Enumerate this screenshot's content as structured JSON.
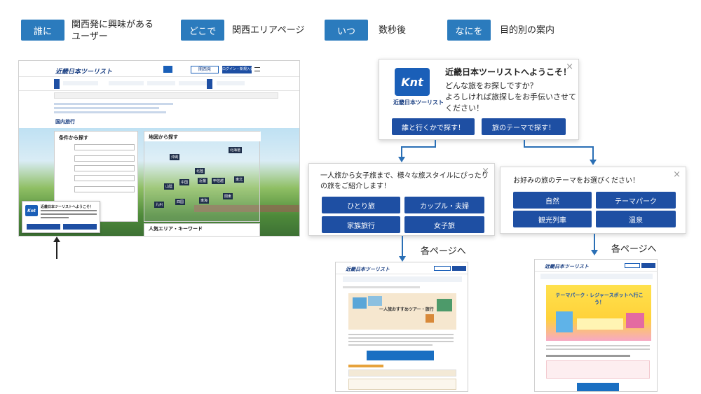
{
  "header_tags": [
    {
      "tag": "誰に",
      "text_line1": "関西発に興味がある",
      "text_line2": "ユーザー"
    },
    {
      "tag": "どこで",
      "text_line1": "関西エリアページ",
      "text_line2": ""
    },
    {
      "tag": "いつ",
      "text_line1": "数秒後",
      "text_line2": ""
    },
    {
      "tag": "なにを",
      "text_line1": "目的別の案内",
      "text_line2": ""
    }
  ],
  "site": {
    "brand": "近畿日本ツーリスト",
    "section_title": "国内旅行",
    "search_label": "条件から探す",
    "map_label": "地図から探す",
    "keyword_label": "人気エリア・キーワード",
    "login": "ログイン・新規入会",
    "region": "関西発",
    "map_regions": [
      "北海道",
      "東北",
      "関東",
      "甲信越",
      "北陸",
      "東海",
      "近畿",
      "中国",
      "四国",
      "九州",
      "沖縄",
      "山陰"
    ]
  },
  "welcome_popup": {
    "logo_text": "Knt",
    "logo_sub": "近畿日本ツーリスト",
    "title": "近畿日本ツーリストへようこそ！",
    "body_line1": "どんな旅をお探しですか？",
    "body_line2": "よろしければ旅探しをお手伝いさせて",
    "body_line3": "ください！",
    "btn_who": "誰と行くかで探す！",
    "btn_theme": "旅のテーマで探す！",
    "close": "×"
  },
  "who_popup": {
    "text_line1": "一人旅から女子旅まで、様々な旅スタイルにぴったり",
    "text_line2": "の旅をご紹介します！",
    "options": [
      "ひとり旅",
      "カップル・夫婦",
      "家族旅行",
      "女子旅"
    ],
    "close": "×"
  },
  "theme_popup": {
    "text_line1": "お好みの旅のテーマをお選びください！",
    "options": [
      "自然",
      "テーマパーク",
      "観光列車",
      "温泉"
    ],
    "close": "×"
  },
  "captions": {
    "left": "各ページへ",
    "right": "各ページへ"
  },
  "result_pages": {
    "left_banner": "一人旅おすすめツアー・旅行",
    "right_banner": "テーマパーク・レジャースポットへ行こう！"
  },
  "colors": {
    "tag_bg": "#2b7bbd",
    "button_bg": "#1e4fa3",
    "arrow": "#2a6fb5"
  }
}
